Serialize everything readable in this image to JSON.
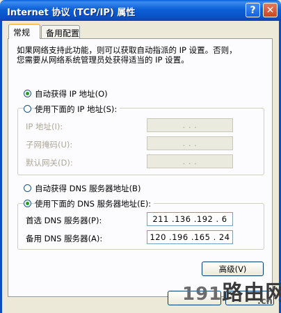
{
  "window": {
    "title": "Internet 协议 (TCP/IP) 属性",
    "help_glyph": "?",
    "close_glyph": "✕"
  },
  "tabs": [
    {
      "label": "常规",
      "selected": true
    },
    {
      "label": "备用配置",
      "selected": false
    }
  ],
  "description": "如果网络支持此功能，则可以获取自动指派的 IP 设置。否则，\n您需要从网络系统管理员处获得适当的 IP 设置。",
  "ip": {
    "auto_label": "自动获得 IP 地址(O)",
    "auto_checked": true,
    "manual_label": "使用下面的 IP 地址(S):",
    "manual_checked": false,
    "fields": [
      {
        "label": "IP 地址(I):",
        "value": ""
      },
      {
        "label": "子网掩码(U):",
        "value": ""
      },
      {
        "label": "默认网关(D):",
        "value": ""
      }
    ],
    "placeholder_dots": ".      .      ."
  },
  "dns": {
    "auto_label": "自动获得 DNS 服务器地址(B)",
    "auto_checked": false,
    "manual_label": "使用下面的 DNS 服务器地址(E):",
    "manual_checked": true,
    "fields": [
      {
        "label": "首选 DNS 服务器(P):",
        "value": "211 .136 .192 . 6"
      },
      {
        "label": "备用 DNS 服务器(A):",
        "value": "120 .196 .165 . 24"
      }
    ]
  },
  "buttons": {
    "advanced": "高级(V)"
  },
  "watermark": {
    "text": "路由网",
    "number": "191",
    "domain": ".cn"
  },
  "colors": {
    "titlebar": "#0a5fd8",
    "dialog_bg": "#ece9d8",
    "radio_dot": "#21a121",
    "tab_highlight": "#ffc83c"
  }
}
